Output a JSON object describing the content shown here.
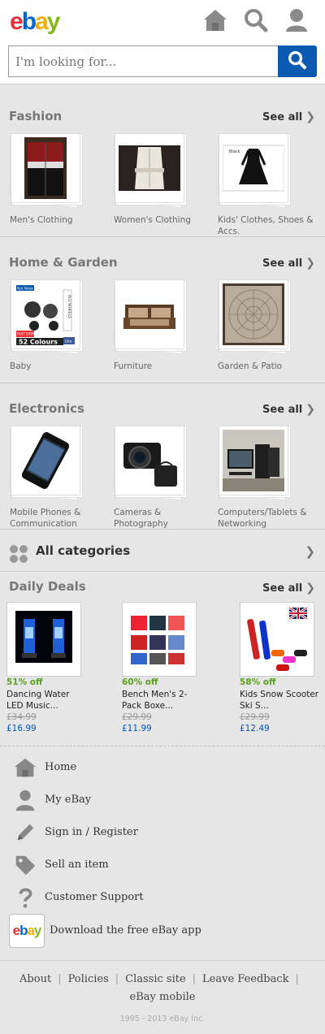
{
  "header": {
    "logo": [
      "e",
      "b",
      "a",
      "y"
    ],
    "icons": [
      "home-icon",
      "search-icon",
      "user-icon"
    ],
    "search_placeholder": "I'm looking for..."
  },
  "sections": [
    {
      "title": "Fashion",
      "see_all": "See all",
      "items": [
        {
          "label": "Men's Clothing",
          "thumb": "jacket"
        },
        {
          "label": "Women's Clothing",
          "thumb": "coat"
        },
        {
          "label": "Kids' Clothes, Shoes & Accs.",
          "thumb": "dress"
        }
      ]
    },
    {
      "title": "Home & Garden",
      "see_all": "See all",
      "items": [
        {
          "label": "Baby",
          "thumb": "pram"
        },
        {
          "label": "Furniture",
          "thumb": "sofa"
        },
        {
          "label": "Garden & Patio",
          "thumb": "patio"
        }
      ]
    },
    {
      "title": "Electronics",
      "see_all": "See all",
      "items": [
        {
          "label": "Mobile Phones & Communication",
          "thumb": "phone"
        },
        {
          "label": "Cameras & Photography",
          "thumb": "camera"
        },
        {
          "label": "Computers/Tablets & Networking",
          "thumb": "computer"
        }
      ]
    }
  ],
  "baby_thumb_text": {
    "top": "Ace Value",
    "side": "ALU WHEELS",
    "badge": "FAST SHIPPING",
    "colours": "52 Colours",
    "like": "Like"
  },
  "dress_thumb_text": "Black",
  "all_categories": "All categories",
  "deals": {
    "title": "Daily Deals",
    "see_all": "See all",
    "items": [
      {
        "off": "51% off",
        "name": "Dancing Water LED Music...",
        "was": "£34.99",
        "now": "£16.99"
      },
      {
        "off": "60% off",
        "name": "Bench Men's 2-Pack Boxe...",
        "was": "£29.99",
        "now": "£11.99"
      },
      {
        "off": "58% off",
        "name": "Kids Snow Scooter Ski S...",
        "was": "£29.99",
        "now": "£12.49"
      }
    ]
  },
  "menu": [
    {
      "label": "Home",
      "icon": "home-icon"
    },
    {
      "label": "My eBay",
      "icon": "user-icon"
    },
    {
      "label": "Sign in / Register",
      "icon": "pencil-icon"
    },
    {
      "label": "Sell an item",
      "icon": "tag-icon"
    },
    {
      "label": "Customer Support",
      "icon": "question-icon"
    }
  ],
  "app": {
    "icon_text": "ebay",
    "label": "Download the free eBay app"
  },
  "footer": {
    "links": [
      "About",
      "Policies",
      "Classic site",
      "Leave Feedback",
      "eBay mobile"
    ],
    "copyright": "1995 - 2013 eBay Inc."
  },
  "colors": {
    "brand_blue": "#0a5ab2",
    "deal_green": "#5ba01e",
    "price_blue": "#0654ba"
  }
}
